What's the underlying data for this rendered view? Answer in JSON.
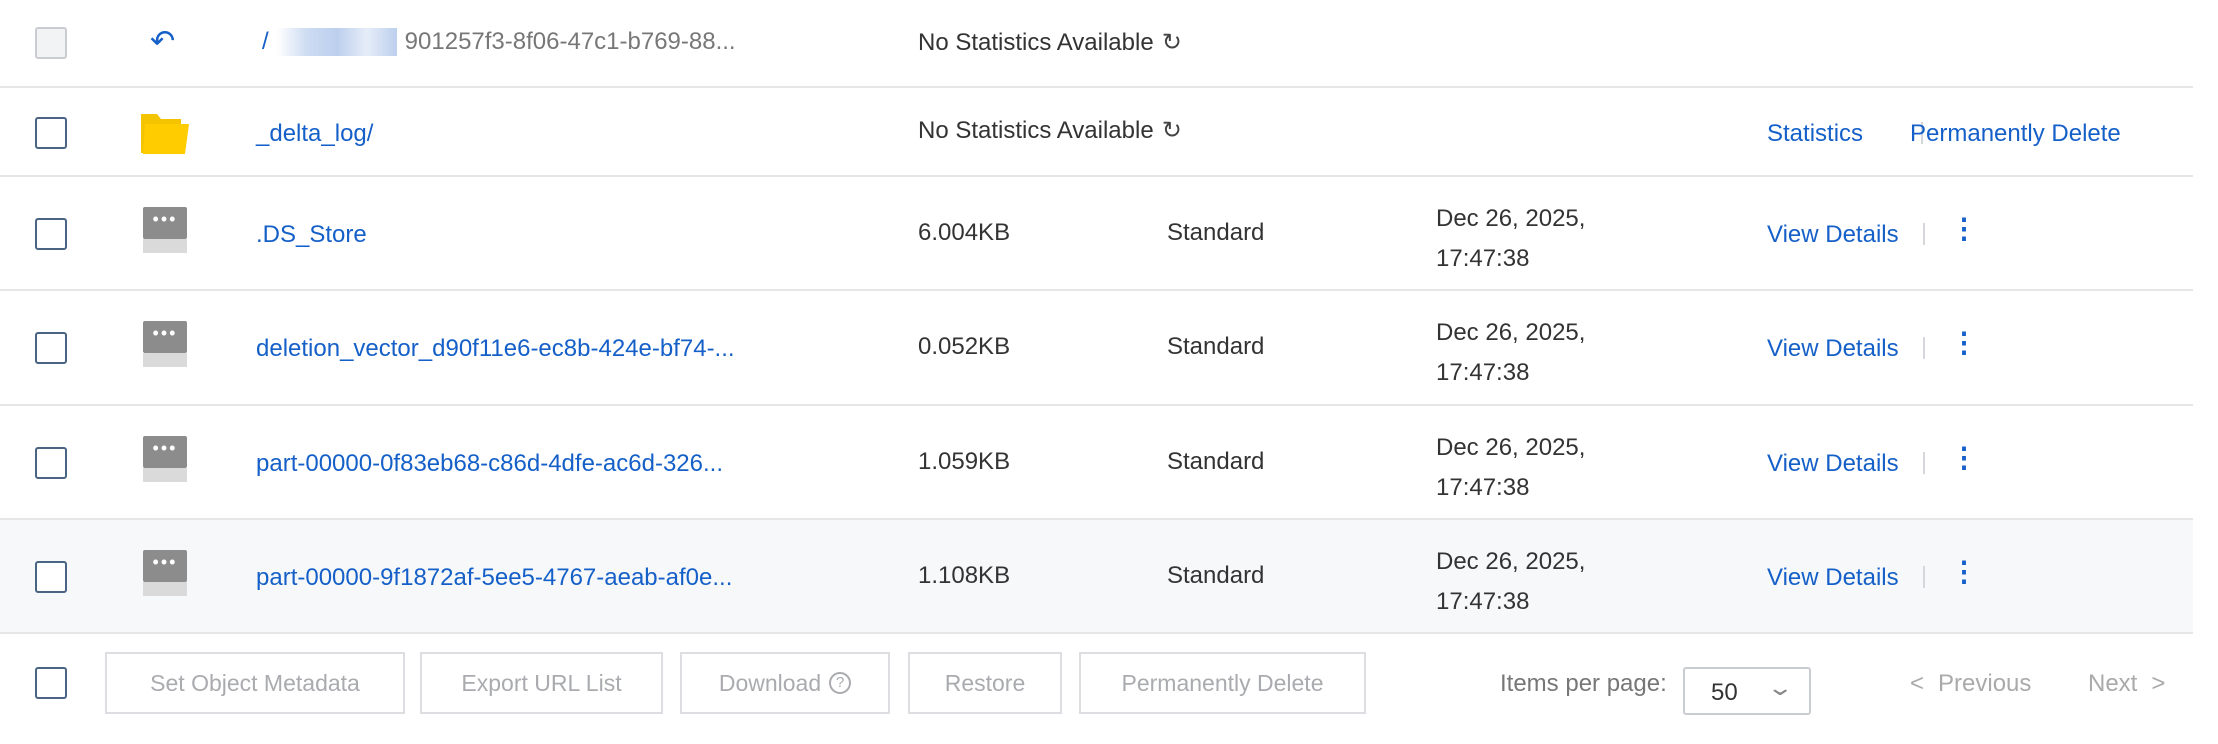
{
  "parent_row": {
    "path_prefix": "/",
    "path_suffix": "901257f3-8f06-47c1-b769-88...",
    "stats": "No Statistics Available"
  },
  "folder_row": {
    "name": "_delta_log/",
    "stats": "No Statistics Available",
    "action_statistics": "Statistics",
    "action_delete": "Permanently Delete"
  },
  "files": [
    {
      "name": ".DS_Store",
      "size": "6.004KB",
      "storage": "Standard",
      "date": "Dec 26, 2025,",
      "time": "17:47:38",
      "action": "View Details"
    },
    {
      "name": "deletion_vector_d90f11e6-ec8b-424e-bf74-...",
      "size": "0.052KB",
      "storage": "Standard",
      "date": "Dec 26, 2025,",
      "time": "17:47:38",
      "action": "View Details"
    },
    {
      "name": "part-00000-0f83eb68-c86d-4dfe-ac6d-326...",
      "size": "1.059KB",
      "storage": "Standard",
      "date": "Dec 26, 2025,",
      "time": "17:47:38",
      "action": "View Details"
    },
    {
      "name": "part-00000-9f1872af-5ee5-4767-aeab-af0e...",
      "size": "1.108KB",
      "storage": "Standard",
      "date": "Dec 26, 2025,",
      "time": "17:47:38",
      "action": "View Details"
    }
  ],
  "footer": {
    "buttons": [
      "Set Object Metadata",
      "Export URL List",
      "Download",
      "Restore",
      "Permanently Delete"
    ],
    "items_per_page_label": "Items per page:",
    "items_per_page_value": "50",
    "previous": "Previous",
    "next": "Next"
  }
}
